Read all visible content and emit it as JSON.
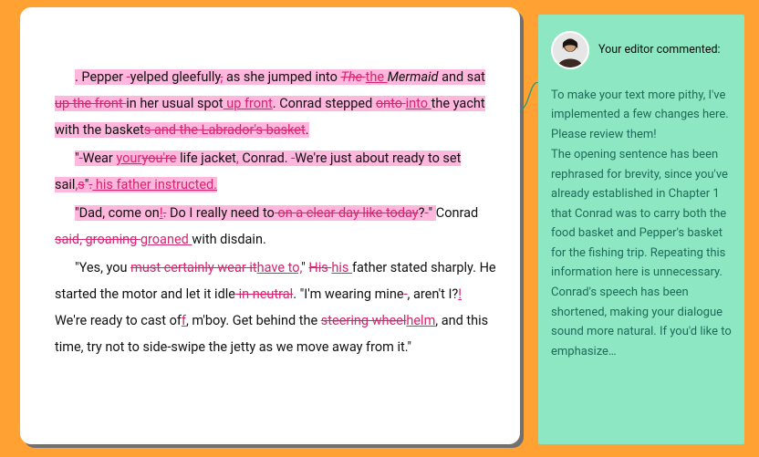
{
  "document": {
    "p1": {
      "t1": ". Pepper ",
      "del1": "-",
      "t2": "yelped gleefully",
      "del2": ",",
      "t3": " as she jumped into ",
      "del3": "The ",
      "ins1": "the ",
      "t4": "Mermaid",
      "t5": " and sat ",
      "del4": "up the front ",
      "t6": "in her usual spot",
      "ins2": " up front",
      "t7": ". Conrad stepped ",
      "del5": "onto ",
      "ins3": "into ",
      "t8": "the yacht with the basket",
      "del6": "s and the Labrador's basket",
      "t9": "."
    },
    "p2": {
      "t1": "\"",
      "del1": "-",
      "t2": "Wear ",
      "ins1": "your",
      "del2": "you're",
      "t3": " life jacket",
      "ins2": ",",
      "t4": " Conrad. ",
      "del3": "-",
      "t5": "We're just about ready to set sail",
      "ins3": ",",
      "del4": "s",
      "t6": "\"",
      "del5": ".",
      "ins4": " his father instructed."
    },
    "p3": {
      "t1": "\"Dad, come on",
      "ins1": "!",
      "del1": ".",
      "t2": " Do I really need to",
      "del2": " on a clear day like today",
      "t3": "?",
      "del3": "-",
      "t4": "\" Conrad ",
      "del4": "said, groaning ",
      "ins2": "groaned ",
      "t5": "with disdain."
    },
    "p4": {
      "t1": "\"Yes, you ",
      "del1": "must certainly wear it",
      "ins1": "have to,",
      "t2": "\" ",
      "del2": "His ",
      "ins2": "his ",
      "t3": "father stated sharply. He started the motor and let it idle",
      "del3": " in neutral",
      "t4": ". \"I'm wearing mine",
      "del4": "-",
      "t5": ", aren't I?",
      "ins3": "!",
      "t6": " We're ready to cast of",
      "ins4": "f",
      "t7": ", m'boy. Get behind the ",
      "del5": "steering wheel",
      "ins5": "helm",
      "t8": ", and this time, try not to side-swipe the jetty as we move away from it.\""
    }
  },
  "comment": {
    "header": "Your editor commented:",
    "body": {
      "l1": "To make your text more pithy, I've implemented a few changes here. Please review them!",
      "l2": "The opening sentence has been rephrased for brevity, since you've already established in Chapter 1 that Conrad was to carry both the food basket and Pepper's basket for the fishing trip. Repeating this information here is unnecessary.",
      "l3": "Conrad's speech has been shortened, making your dialogue sound more natural. If you'd like to emphasize…"
    }
  }
}
